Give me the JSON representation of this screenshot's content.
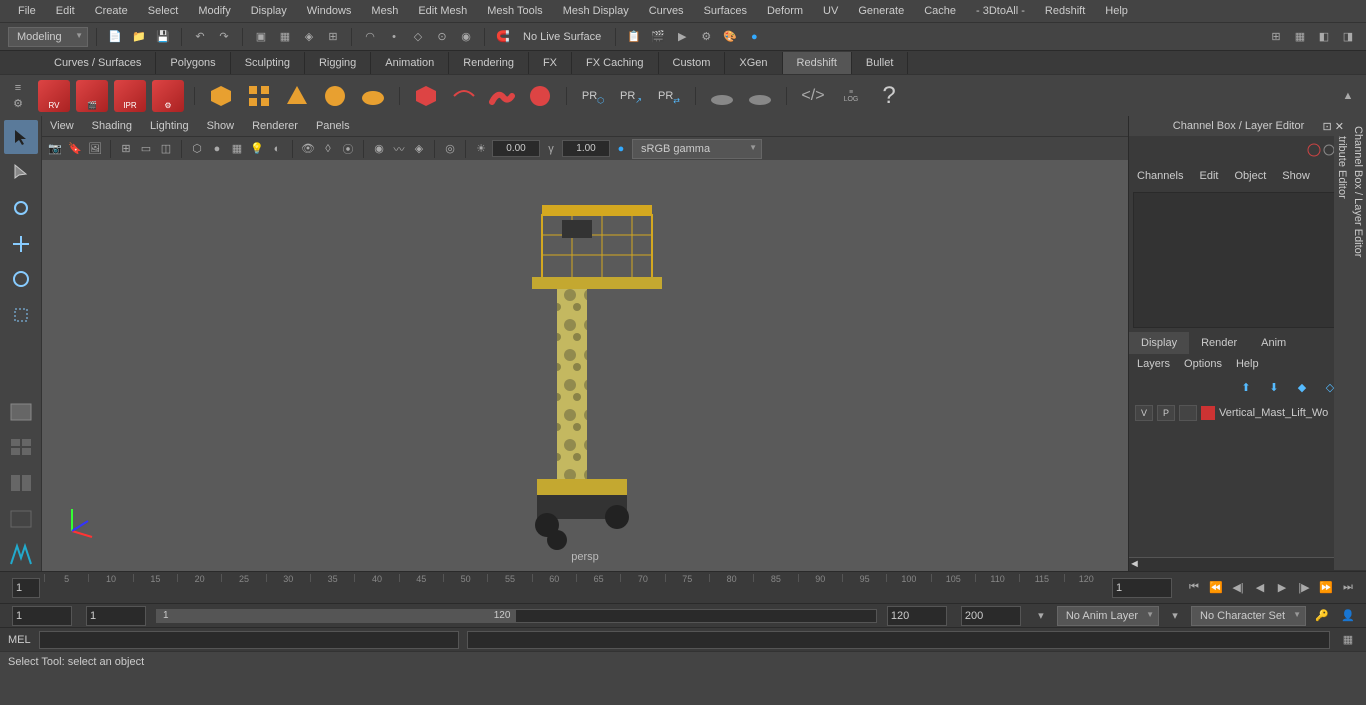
{
  "menubar": [
    "File",
    "Edit",
    "Create",
    "Select",
    "Modify",
    "Display",
    "Windows",
    "Mesh",
    "Edit Mesh",
    "Mesh Tools",
    "Mesh Display",
    "Curves",
    "Surfaces",
    "Deform",
    "UV",
    "Generate",
    "Cache",
    "- 3DtoAll -",
    "Redshift",
    "Help"
  ],
  "workspace_dropdown": "Modeling",
  "no_live_surface": "No Live Surface",
  "tabs": [
    "Curves / Surfaces",
    "Polygons",
    "Sculpting",
    "Rigging",
    "Animation",
    "Rendering",
    "FX",
    "FX Caching",
    "Custom",
    "XGen",
    "Redshift",
    "Bullet"
  ],
  "active_tab": "Redshift",
  "shelf_labels": {
    "rv": "RV",
    "ipr": "IPR",
    "pr": "PR"
  },
  "viewport_menu": [
    "View",
    "Shading",
    "Lighting",
    "Show",
    "Renderer",
    "Panels"
  ],
  "viewport": {
    "exposure": "0.00",
    "gamma": "1.00",
    "colorspace": "sRGB gamma",
    "camera": "persp"
  },
  "channel_box": {
    "title": "Channel Box / Layer Editor",
    "tabs": [
      "Channels",
      "Edit",
      "Object",
      "Show"
    ]
  },
  "layer_editor": {
    "tabs": [
      "Display",
      "Render",
      "Anim"
    ],
    "active": "Display",
    "options": [
      "Layers",
      "Options",
      "Help"
    ],
    "row": {
      "v": "V",
      "p": "P",
      "name": "Vertical_Mast_Lift_Wo"
    }
  },
  "right_side_tabs": [
    "Channel Box / Layer Editor",
    "Attribute Editor"
  ],
  "timeline": {
    "start": "1",
    "current": "1",
    "marks": [
      "5",
      "10",
      "15",
      "20",
      "25",
      "30",
      "35",
      "40",
      "45",
      "50",
      "55",
      "60",
      "65",
      "70",
      "75",
      "80",
      "85",
      "90",
      "95",
      "100",
      "105",
      "110",
      "115",
      "120"
    ]
  },
  "range": {
    "start": "1",
    "playback_start": "1",
    "playback_end": "120",
    "end": "200",
    "slider_label": "1",
    "slider_end": "120",
    "anim_layer": "No Anim Layer",
    "char_set": "No Character Set"
  },
  "cmd": {
    "label": "MEL"
  },
  "status": "Select Tool: select an object"
}
